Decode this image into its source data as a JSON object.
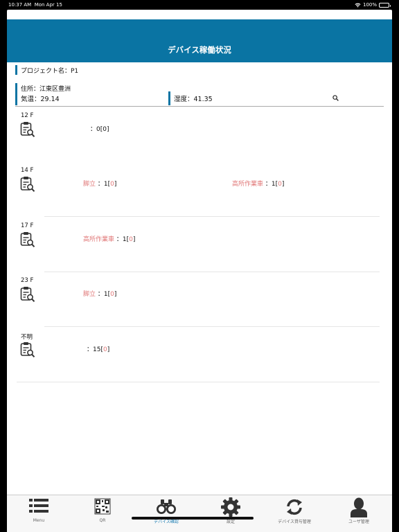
{
  "status": {
    "time": "10:37 AM",
    "date": "Mon Apr 15",
    "battery": "100%"
  },
  "header": {
    "title": "デバイス稼働状況"
  },
  "project": {
    "label": "プロジェクト名：P1"
  },
  "address": {
    "label": "住所：江東区豊洲"
  },
  "weather": {
    "temperature": "気温：29.14",
    "humidity": "湿度：41.35"
  },
  "floors": [
    {
      "name": "12 F",
      "items": [
        {
          "category": "",
          "prefix": "：0[",
          "inner": "0",
          "suffix": "]"
        }
      ]
    },
    {
      "name": "14 F",
      "items": [
        {
          "category": "脚立",
          "prefix": "：1[",
          "inner": "0",
          "suffix": "]"
        },
        {
          "category": "高所作業車",
          "prefix": "：1[",
          "inner": "0",
          "suffix": "]"
        }
      ]
    },
    {
      "name": "17 F",
      "items": [
        {
          "category": "高所作業車",
          "prefix": "：1[",
          "inner": "0",
          "suffix": "]"
        }
      ]
    },
    {
      "name": "23 F",
      "items": [
        {
          "category": "脚立",
          "prefix": "：1[",
          "inner": "0",
          "suffix": "]"
        }
      ]
    },
    {
      "name": "不明",
      "items": [
        {
          "category": "",
          "prefix": "：15[",
          "inner": "0",
          "suffix": "]"
        }
      ]
    }
  ],
  "tabs": [
    {
      "label": "Menu",
      "icon": "menu-list-icon"
    },
    {
      "label": "QR",
      "icon": "qr-code-icon"
    },
    {
      "label": "デバイス確認",
      "icon": "binoculars-icon"
    },
    {
      "label": "設定",
      "icon": "gear-icon"
    },
    {
      "label": "デバイス貸与管理",
      "icon": "sync-arrows-icon"
    },
    {
      "label": "ユーザ管理",
      "icon": "user-icon"
    }
  ],
  "colors": {
    "accent": "#0a74a3",
    "category_text": "#e07777",
    "active_tab": "#1a7bb0"
  }
}
